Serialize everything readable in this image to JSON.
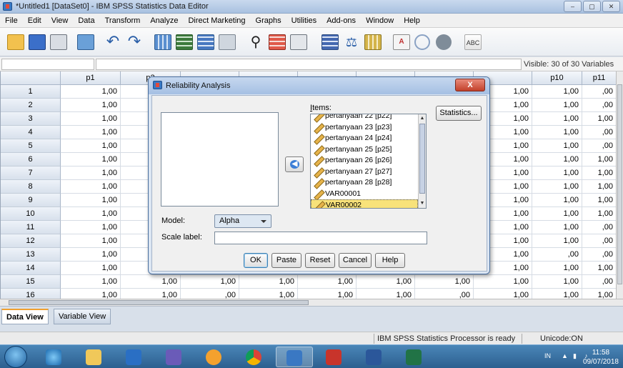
{
  "window": {
    "title": "*Untitled1 [DataSet0] - IBM SPSS Statistics Data Editor",
    "controls": [
      "–",
      "▢",
      "✕"
    ]
  },
  "menu": [
    "File",
    "Edit",
    "View",
    "Data",
    "Transform",
    "Analyze",
    "Direct Marketing",
    "Graphs",
    "Utilities",
    "Add-ons",
    "Window",
    "Help"
  ],
  "toolbar": {
    "icons": [
      "open-icon",
      "save-icon",
      "print-icon",
      "recall-dialog-icon",
      "undo-icon",
      "redo-icon",
      "goto-case-icon",
      "goto-variable-icon",
      "variables-icon",
      "run-icon",
      "find-icon",
      "insert-cases-icon",
      "insert-variable-icon",
      "split-file-icon",
      "weight-cases-icon",
      "select-cases-icon",
      "value-labels-icon",
      "use-sets-icon",
      "show-all-icon",
      "spelling-icon"
    ],
    "spell_label": "ABC"
  },
  "grid": {
    "visible_text": "Visible: 30 of 30 Variables",
    "headers": [
      "p1",
      "p2",
      "",
      "",
      "",
      "",
      "",
      "",
      "",
      "p10",
      "p11"
    ],
    "row_numbers": [
      "1",
      "2",
      "3",
      "4",
      "5",
      "6",
      "7",
      "8",
      "9",
      "10",
      "11",
      "12",
      "13",
      "14",
      "15",
      "16"
    ],
    "col_p1": [
      "1,00",
      "1,00",
      "1,00",
      "1,00",
      "1,00",
      "1,00",
      "1,00",
      "1,00",
      "1,00",
      "1,00",
      "1,00",
      "1,00",
      "1,00",
      "1,00",
      "1,00",
      "1,00"
    ],
    "col_p2_partial": [
      "1,",
      "1,",
      "1,",
      "1,",
      "1,",
      "1,",
      "1,",
      "1,",
      "1,",
      "1,",
      "1,",
      "1,",
      "1,",
      "1,",
      "1,00",
      "1,00"
    ],
    "col_p9_partial": [
      "1,00",
      "1,00",
      "1,00",
      "1,00",
      "1,00",
      "1,00",
      "1,00",
      "1,00",
      "1,00",
      "1,00",
      "1,00",
      "1,00",
      "1,00",
      "1,00",
      "1,00",
      "1,00"
    ],
    "col_p10": [
      "1,00",
      "1,00",
      "1,00",
      "1,00",
      "1,00",
      "1,00",
      "1,00",
      "1,00",
      "1,00",
      "1,00",
      "1,00",
      "1,00",
      ",00",
      "1,00",
      "1,00",
      "1,00"
    ],
    "col_p11": [
      ",00",
      ",00",
      "1,00",
      ",00",
      ",00",
      "1,00",
      "1,00",
      "1,00",
      "1,00",
      "1,00",
      ",00",
      ",00",
      ",00",
      "1,00",
      ",00",
      "1,00"
    ],
    "row15_mid": [
      "1,00",
      "1,00",
      "1,00",
      "1,00",
      "1,00",
      "1,00"
    ],
    "row16_mid": [
      ",00",
      "1,00",
      "1,00",
      "1,00",
      ",00",
      "1,00"
    ]
  },
  "tabs": [
    "Data View",
    "Variable View"
  ],
  "status": {
    "processor": "IBM SPSS Statistics Processor is ready",
    "unicode": "Unicode:ON"
  },
  "taskbar": {
    "lang": "IN",
    "time": "11:58",
    "date": "09/07/2018"
  },
  "dialog": {
    "title": "Reliability Analysis",
    "close_label": "X",
    "items_label": "Items:",
    "items": [
      "pertanyaan 22 [p22]",
      "pertanyaan 23 [p23]",
      "pertanyaan 24 [p24]",
      "pertanyaan 25 [p25]",
      "pertanyaan 26 [p26]",
      "pertanyaan 27 [p27]",
      "pertanyaan 28 [p28]",
      "VAR00001",
      "VAR00002"
    ],
    "selected_item": "VAR00002",
    "model_label": "Model:",
    "model_value": "Alpha",
    "scale_label": "Scale label:",
    "scale_value": "",
    "buttons": {
      "statistics": "Statistics...",
      "ok": "OK",
      "paste": "Paste",
      "reset": "Reset",
      "cancel": "Cancel",
      "help": "Help"
    }
  }
}
